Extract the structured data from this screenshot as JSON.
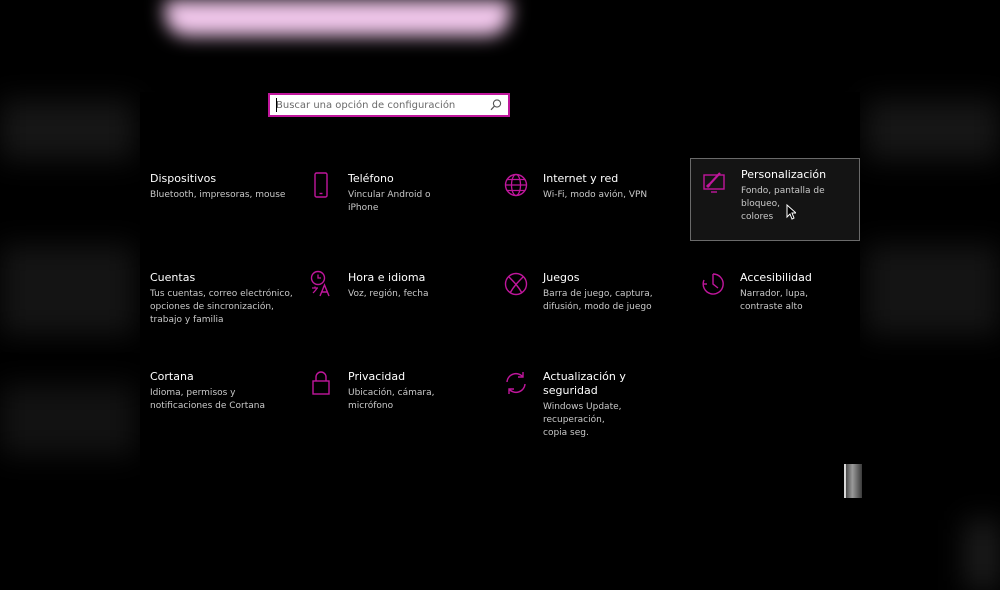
{
  "search": {
    "placeholder": "Buscar una opción de configuración"
  },
  "accent_color": "#c0169c",
  "tiles": [
    {
      "title": "Dispositivos",
      "desc": "Bluetooth, impresoras, mouse",
      "icon": "devices-icon"
    },
    {
      "title": "Teléfono",
      "desc": "Vincular Android o iPhone",
      "icon": "phone-icon"
    },
    {
      "title": "Internet y red",
      "desc": "Wi-Fi, modo avión, VPN",
      "icon": "globe-icon"
    },
    {
      "title": "Personalización",
      "desc": "Fondo, pantalla de bloqueo,\ncolores",
      "icon": "personalization-icon",
      "selected": true
    },
    {
      "title": "Cuentas",
      "desc": "Tus cuentas, correo electrónico,\nopciones de sincronización,\ntrabajo y familia",
      "icon": "accounts-icon"
    },
    {
      "title": "Hora e idioma",
      "desc": "Voz, región, fecha",
      "icon": "time-language-icon"
    },
    {
      "title": "Juegos",
      "desc": "Barra de juego, captura,\ndifusión, modo de juego",
      "icon": "xbox-icon"
    },
    {
      "title": "Accesibilidad",
      "desc": "Narrador, lupa, contraste alto",
      "icon": "accessibility-icon"
    },
    {
      "title": "Cortana",
      "desc": "Idioma, permisos y\nnotificaciones de Cortana",
      "icon": "cortana-icon"
    },
    {
      "title": "Privacidad",
      "desc": "Ubicación, cámara, micrófono",
      "icon": "lock-icon"
    },
    {
      "title": "Actualización y seguridad",
      "desc": "Windows Update, recuperación,\ncopia seg.",
      "icon": "update-icon"
    }
  ]
}
